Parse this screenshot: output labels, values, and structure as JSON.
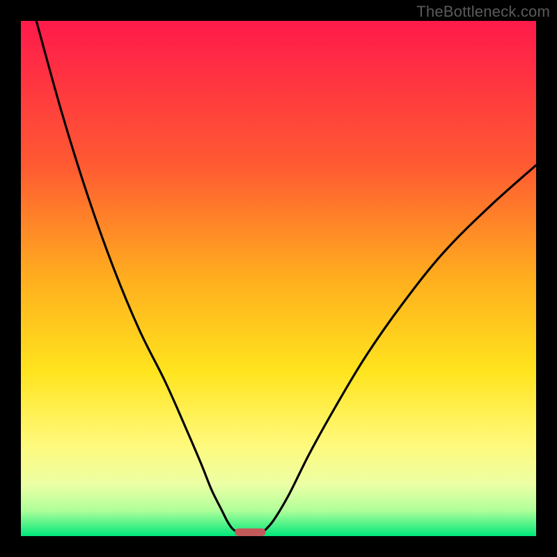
{
  "watermark": "TheBottleneck.com",
  "chart_data": {
    "type": "line",
    "title": "",
    "xlabel": "",
    "ylabel": "",
    "xlim": [
      0,
      100
    ],
    "ylim": [
      0,
      100
    ],
    "grid": false,
    "background_gradient": {
      "stops": [
        {
          "offset": 0.0,
          "color": "#ff1a4b"
        },
        {
          "offset": 0.28,
          "color": "#ff5a32"
        },
        {
          "offset": 0.5,
          "color": "#ffae1e"
        },
        {
          "offset": 0.68,
          "color": "#ffe41e"
        },
        {
          "offset": 0.82,
          "color": "#fff97a"
        },
        {
          "offset": 0.9,
          "color": "#ecffa5"
        },
        {
          "offset": 0.95,
          "color": "#b0ff9a"
        },
        {
          "offset": 1.0,
          "color": "#00e87a"
        }
      ]
    },
    "series": [
      {
        "name": "left-curve",
        "description": "descending convex curve from top-left down to minimum",
        "x": [
          3,
          8,
          13,
          18,
          23,
          28,
          32,
          35,
          37,
          39,
          40,
          41,
          42
        ],
        "y": [
          100,
          82,
          66,
          52,
          40,
          30,
          21,
          14,
          9,
          5,
          3,
          1.5,
          0.8
        ]
      },
      {
        "name": "right-curve",
        "description": "ascending concave curve from minimum up toward right",
        "x": [
          47,
          49,
          52,
          56,
          61,
          67,
          74,
          82,
          91,
          100
        ],
        "y": [
          0.8,
          3,
          8,
          16,
          25,
          35,
          45,
          55,
          64,
          72
        ]
      }
    ],
    "marker": {
      "name": "minimum-bar",
      "shape": "rounded-rect",
      "x_center": 44.5,
      "y": 0,
      "width": 6,
      "height": 1.5,
      "color": "#c35a5a"
    }
  }
}
